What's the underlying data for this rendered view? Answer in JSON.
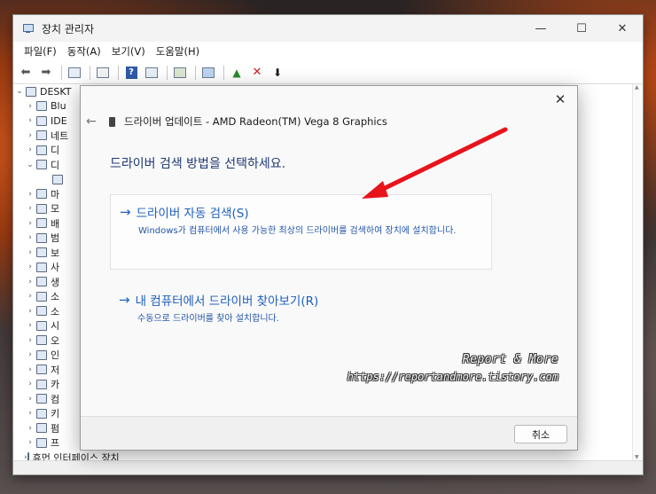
{
  "window": {
    "title": "장치 관리자",
    "controls": {
      "minimize": "—",
      "maximize": "☐",
      "close": "✕"
    }
  },
  "menu": [
    "파일(F)",
    "동작(A)",
    "보기(V)",
    "도움말(H)"
  ],
  "toolbar_icons": [
    "back-arrow-icon",
    "forward-arrow-icon",
    "properties-icon",
    "list-icon",
    "help-icon",
    "view-icon",
    "update-driver-icon",
    "monitor-icon",
    "enable-device-icon",
    "remove-icon",
    "download-icon"
  ],
  "tree": {
    "root": "DESKT",
    "items": [
      {
        "label": "Blu",
        "chev": "›"
      },
      {
        "label": "IDE",
        "chev": "›"
      },
      {
        "label": "네트",
        "chev": "›"
      },
      {
        "label": "디",
        "chev": "›"
      },
      {
        "label": "디",
        "chev": "⌄"
      },
      {
        "label": "",
        "chev": ""
      },
      {
        "label": "마",
        "chev": "›"
      },
      {
        "label": "모",
        "chev": "›"
      },
      {
        "label": "배",
        "chev": "›"
      },
      {
        "label": "범",
        "chev": "›"
      },
      {
        "label": "보",
        "chev": "›"
      },
      {
        "label": "사",
        "chev": "›"
      },
      {
        "label": "생",
        "chev": "›"
      },
      {
        "label": "소",
        "chev": "›"
      },
      {
        "label": "소",
        "chev": "›"
      },
      {
        "label": "시",
        "chev": "›"
      },
      {
        "label": "오",
        "chev": "›"
      },
      {
        "label": "인",
        "chev": "›"
      },
      {
        "label": "저",
        "chev": "›"
      },
      {
        "label": "카",
        "chev": "›"
      },
      {
        "label": "컴",
        "chev": "›"
      },
      {
        "label": "키",
        "chev": "›"
      },
      {
        "label": "펌",
        "chev": "›"
      },
      {
        "label": "프",
        "chev": "›"
      },
      {
        "label": "휴먼 인터페이스 장치",
        "chev": "›"
      }
    ]
  },
  "dialog": {
    "back": "←",
    "close": "✕",
    "header": "드라이버 업데이트 - AMD Radeon(TM) Vega 8 Graphics",
    "question": "드라이버 검색 방법을 선택하세요.",
    "option_auto": {
      "arrow": "→",
      "title": "드라이버 자동 검색(S)",
      "desc": "Windows가 컴퓨터에서 사용 가능한 최상의 드라이버를 검색하여 장치에 설치합니다."
    },
    "option_manual": {
      "arrow": "→",
      "title": "내 컴퓨터에서 드라이버 찾아보기(R)",
      "desc": "수동으로 드라이버를 찾아 설치합니다."
    },
    "cancel": "취소"
  },
  "watermark": {
    "brand": "Report & More",
    "url": "https://reportandmore.tistory.com"
  },
  "colors": {
    "link_blue": "#1f5fbf",
    "annotation_red": "#e8141c"
  }
}
